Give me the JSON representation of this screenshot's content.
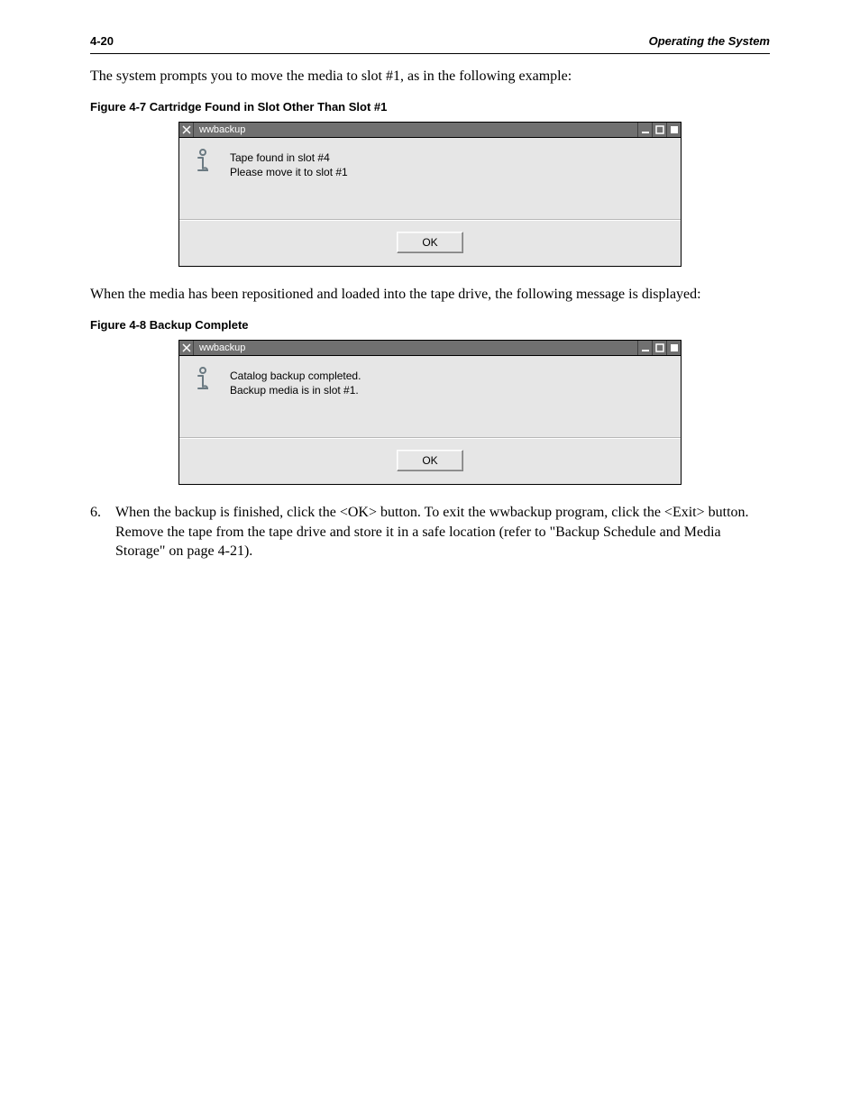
{
  "header": {
    "left": "4-20",
    "right": "Operating the System"
  },
  "intro_para": "The system prompts you to move the media to slot #1, as in the following example:",
  "figure7": {
    "caption": "Figure 4-7 Cartridge Found in Slot Other Than Slot #1",
    "dialog_title": "wwbackup",
    "message": "Tape found in slot #4\nPlease move it to slot #1",
    "ok_label": "OK"
  },
  "between_para": "When the media has been repositioned and loaded into the tape drive, the following message is displayed:",
  "figure8": {
    "caption": "Figure 4-8 Backup Complete",
    "dialog_title": "wwbackup",
    "message": "Catalog backup completed.\nBackup media is in slot #1.",
    "ok_label": "OK"
  },
  "step6_lead": "6.",
  "step6_text": "When the backup is finished, click the <OK> button. To exit the wwbackup program, click the <Exit> button. Remove the tape from the tape drive and store it in a safe location (refer to \"Backup Schedule and Media Storage\" on page 4-21)."
}
